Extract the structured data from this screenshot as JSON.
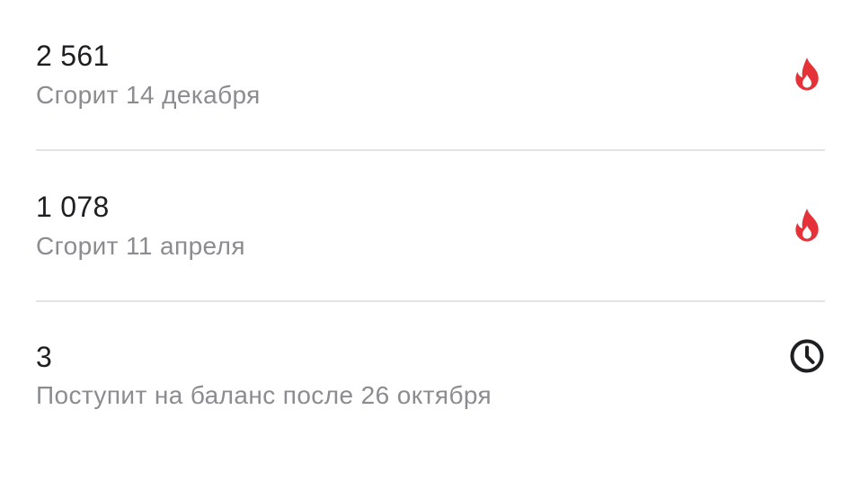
{
  "colors": {
    "primary_text": "#1e1f21",
    "secondary_text": "#8a8c90",
    "fire": "#e53238",
    "clock": "#1e1f21",
    "divider": "#e2e3e5"
  },
  "items": [
    {
      "amount": "2 561",
      "caption": "Сгорит 14 декабря",
      "icon": "fire-icon"
    },
    {
      "amount": "1 078",
      "caption": "Сгорит 11 апреля",
      "icon": "fire-icon"
    },
    {
      "amount": "3",
      "caption": "Поступит на баланс после 26 октября",
      "icon": "clock-icon"
    }
  ]
}
